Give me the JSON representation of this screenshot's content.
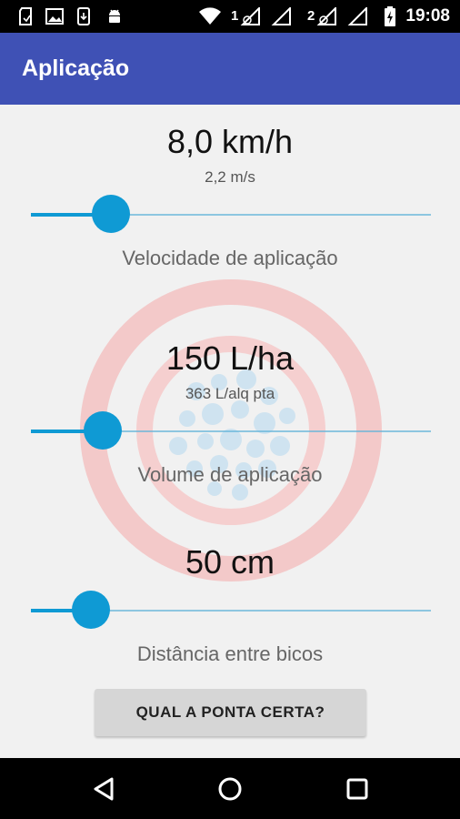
{
  "status_bar": {
    "time": "19:08",
    "sim1": "1",
    "sim2": "2",
    "icons": [
      "sd-card-icon",
      "image-icon",
      "phone-download-icon",
      "android-icon",
      "wifi-icon",
      "signal-sim1-icon",
      "signal-sim2-icon",
      "battery-charging-icon"
    ]
  },
  "app_bar": {
    "title": "Aplicação",
    "color": "#3f51b5"
  },
  "speed": {
    "value": "8,0 km/h",
    "secondary": "2,2 m/s",
    "label": "Velocidade de aplicação",
    "slider_level": 0.2
  },
  "volume": {
    "value": "150 L/ha",
    "secondary": "363 L/alq pta",
    "label": "Volume de aplicação",
    "slider_level": 0.18
  },
  "spacing": {
    "value": "50 cm",
    "label": "Distância entre bicos",
    "slider_level": 0.15
  },
  "action_button": {
    "label": "QUAL A PONTA CERTA?"
  },
  "nav_bar": {
    "icons": [
      "back-icon",
      "home-icon",
      "recents-icon"
    ]
  },
  "colors": {
    "accent": "#0f9ad4",
    "background": "#f1f1f1"
  }
}
